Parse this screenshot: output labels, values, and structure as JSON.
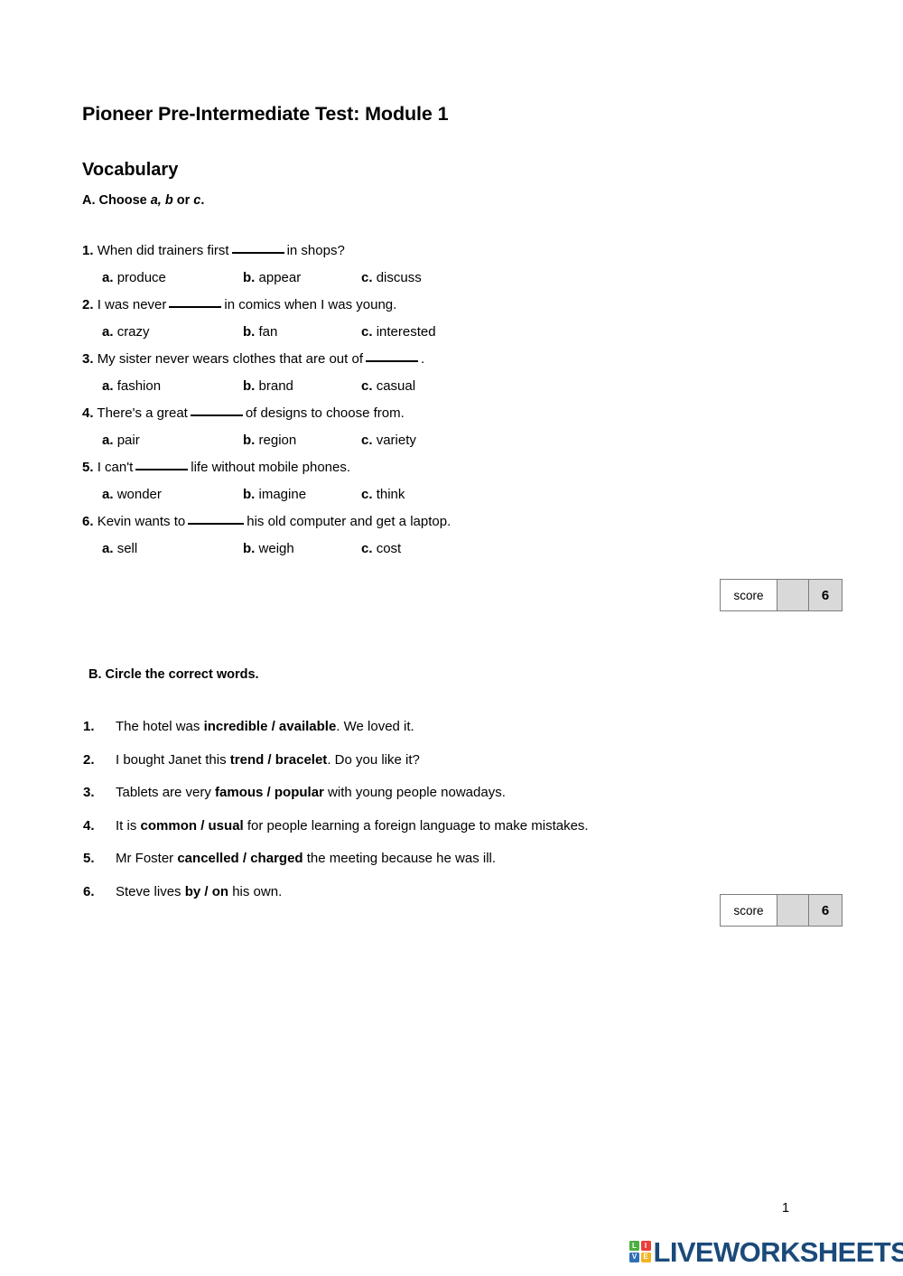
{
  "document": {
    "title": "Pioneer Pre-Intermediate Test: Module 1",
    "section_title": "Vocabulary",
    "page_number": "1"
  },
  "exercise_a": {
    "heading_prefix": "A. Choose ",
    "heading_italic_1": "a, b",
    "heading_mid": " or ",
    "heading_italic_2": "c",
    "heading_suffix": ".",
    "questions": [
      {
        "number": "1.",
        "stem_before": "When did trainers first",
        "stem_after": "in shops?",
        "options": [
          {
            "letter": "a.",
            "text": "produce"
          },
          {
            "letter": "b.",
            "text": "appear"
          },
          {
            "letter": "c.",
            "text": "discuss"
          }
        ]
      },
      {
        "number": "2.",
        "stem_before": "I was never",
        "stem_after": "in comics when I was young.",
        "options": [
          {
            "letter": "a.",
            "text": "crazy"
          },
          {
            "letter": "b.",
            "text": "fan"
          },
          {
            "letter": "c.",
            "text": "interested"
          }
        ]
      },
      {
        "number": "3.",
        "stem_before": "My sister never wears clothes that are out of",
        "stem_after": ".",
        "options": [
          {
            "letter": "a.",
            "text": "fashion"
          },
          {
            "letter": "b.",
            "text": "brand"
          },
          {
            "letter": "c.",
            "text": "casual"
          }
        ]
      },
      {
        "number": "4.",
        "stem_before": "There's a great",
        "stem_after": "of designs to choose from.",
        "options": [
          {
            "letter": "a.",
            "text": "pair"
          },
          {
            "letter": "b.",
            "text": "region"
          },
          {
            "letter": "c.",
            "text": "variety"
          }
        ]
      },
      {
        "number": "5.",
        "stem_before": "I can't",
        "stem_after": "life without mobile phones.",
        "options": [
          {
            "letter": "a.",
            "text": "wonder"
          },
          {
            "letter": "b.",
            "text": "imagine"
          },
          {
            "letter": "c.",
            "text": "think"
          }
        ]
      },
      {
        "number": "6.",
        "stem_before": "Kevin wants to",
        "stem_after": "his old computer and get a laptop.",
        "options": [
          {
            "letter": "a.",
            "text": "sell"
          },
          {
            "letter": "b.",
            "text": "weigh"
          },
          {
            "letter": "c.",
            "text": "cost"
          }
        ]
      }
    ],
    "score": {
      "label": "score",
      "value": "",
      "total": "6"
    }
  },
  "exercise_b": {
    "heading": "B. Circle the correct words.",
    "questions": [
      {
        "number": "1.",
        "before": "The hotel was ",
        "choice": "incredible / available",
        "after": ". We loved it."
      },
      {
        "number": "2.",
        "before": "I bought Janet this ",
        "choice": "trend / bracelet",
        "after": ". Do you like it?"
      },
      {
        "number": "3.",
        "before": "Tablets are very ",
        "choice": "famous / popular",
        "after": " with young people nowadays."
      },
      {
        "number": "4.",
        "before": "It is ",
        "choice": "common / usual",
        "after": " for people learning a foreign language to make mistakes."
      },
      {
        "number": "5.",
        "before": "Mr Foster ",
        "choice": "cancelled / charged",
        "after": " the meeting because he was ill."
      },
      {
        "number": "6.",
        "before": "Steve lives ",
        "choice": "by / on",
        "after": " his own."
      }
    ],
    "score": {
      "label": "score",
      "value": "",
      "total": "6"
    }
  },
  "footer": {
    "logo_tiles": [
      "L",
      "I",
      "V",
      "E"
    ],
    "logo_word": "LIVEWORKSHEETS",
    "colors": {
      "tile_l": "#4caf3f",
      "tile_i": "#e8403a",
      "tile_v": "#2f6fb5",
      "tile_e": "#f2b422",
      "word": "#1b4a7a"
    }
  }
}
